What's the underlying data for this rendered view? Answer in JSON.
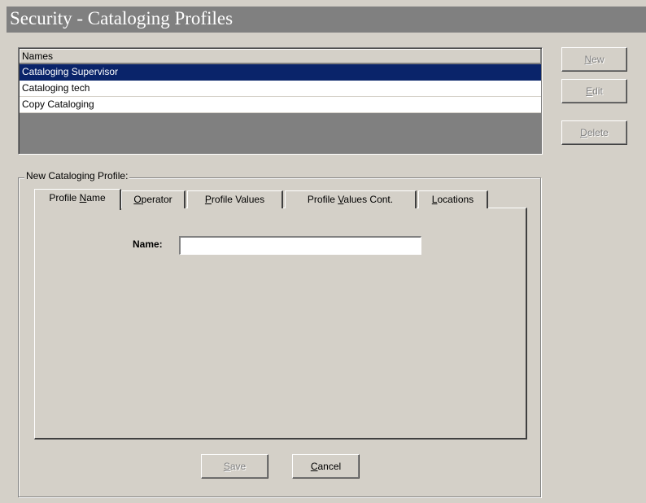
{
  "window": {
    "title": "Security - Cataloging Profiles"
  },
  "names_list": {
    "header": "Names",
    "rows": [
      "Cataloging Supervisor",
      "Cataloging tech",
      "Copy Cataloging"
    ],
    "selected_index": 0
  },
  "side_buttons": {
    "new": {
      "pre": "",
      "key": "N",
      "post": "ew"
    },
    "edit": {
      "pre": "",
      "key": "E",
      "post": "dit"
    },
    "delete": {
      "pre": "",
      "key": "D",
      "post": "elete"
    }
  },
  "group": {
    "label": "New  Cataloging Profile:"
  },
  "tabs": [
    {
      "pre": "Profile ",
      "key": "N",
      "post": "ame"
    },
    {
      "pre": "",
      "key": "O",
      "post": "perator"
    },
    {
      "pre": "",
      "key": "P",
      "post": "rofile Values"
    },
    {
      "pre": "Profile ",
      "key": "V",
      "post": "alues Cont."
    },
    {
      "pre": "",
      "key": "L",
      "post": "ocations"
    }
  ],
  "form": {
    "name_label": "Name:",
    "name_value": ""
  },
  "footer_buttons": {
    "save": {
      "pre": "",
      "key": "S",
      "post": "ave"
    },
    "cancel": {
      "pre": "",
      "key": "C",
      "post": "ancel"
    }
  },
  "colors": {
    "selection": "#0a246a",
    "face": "#d4d0c8",
    "title_bar": "#808080"
  }
}
